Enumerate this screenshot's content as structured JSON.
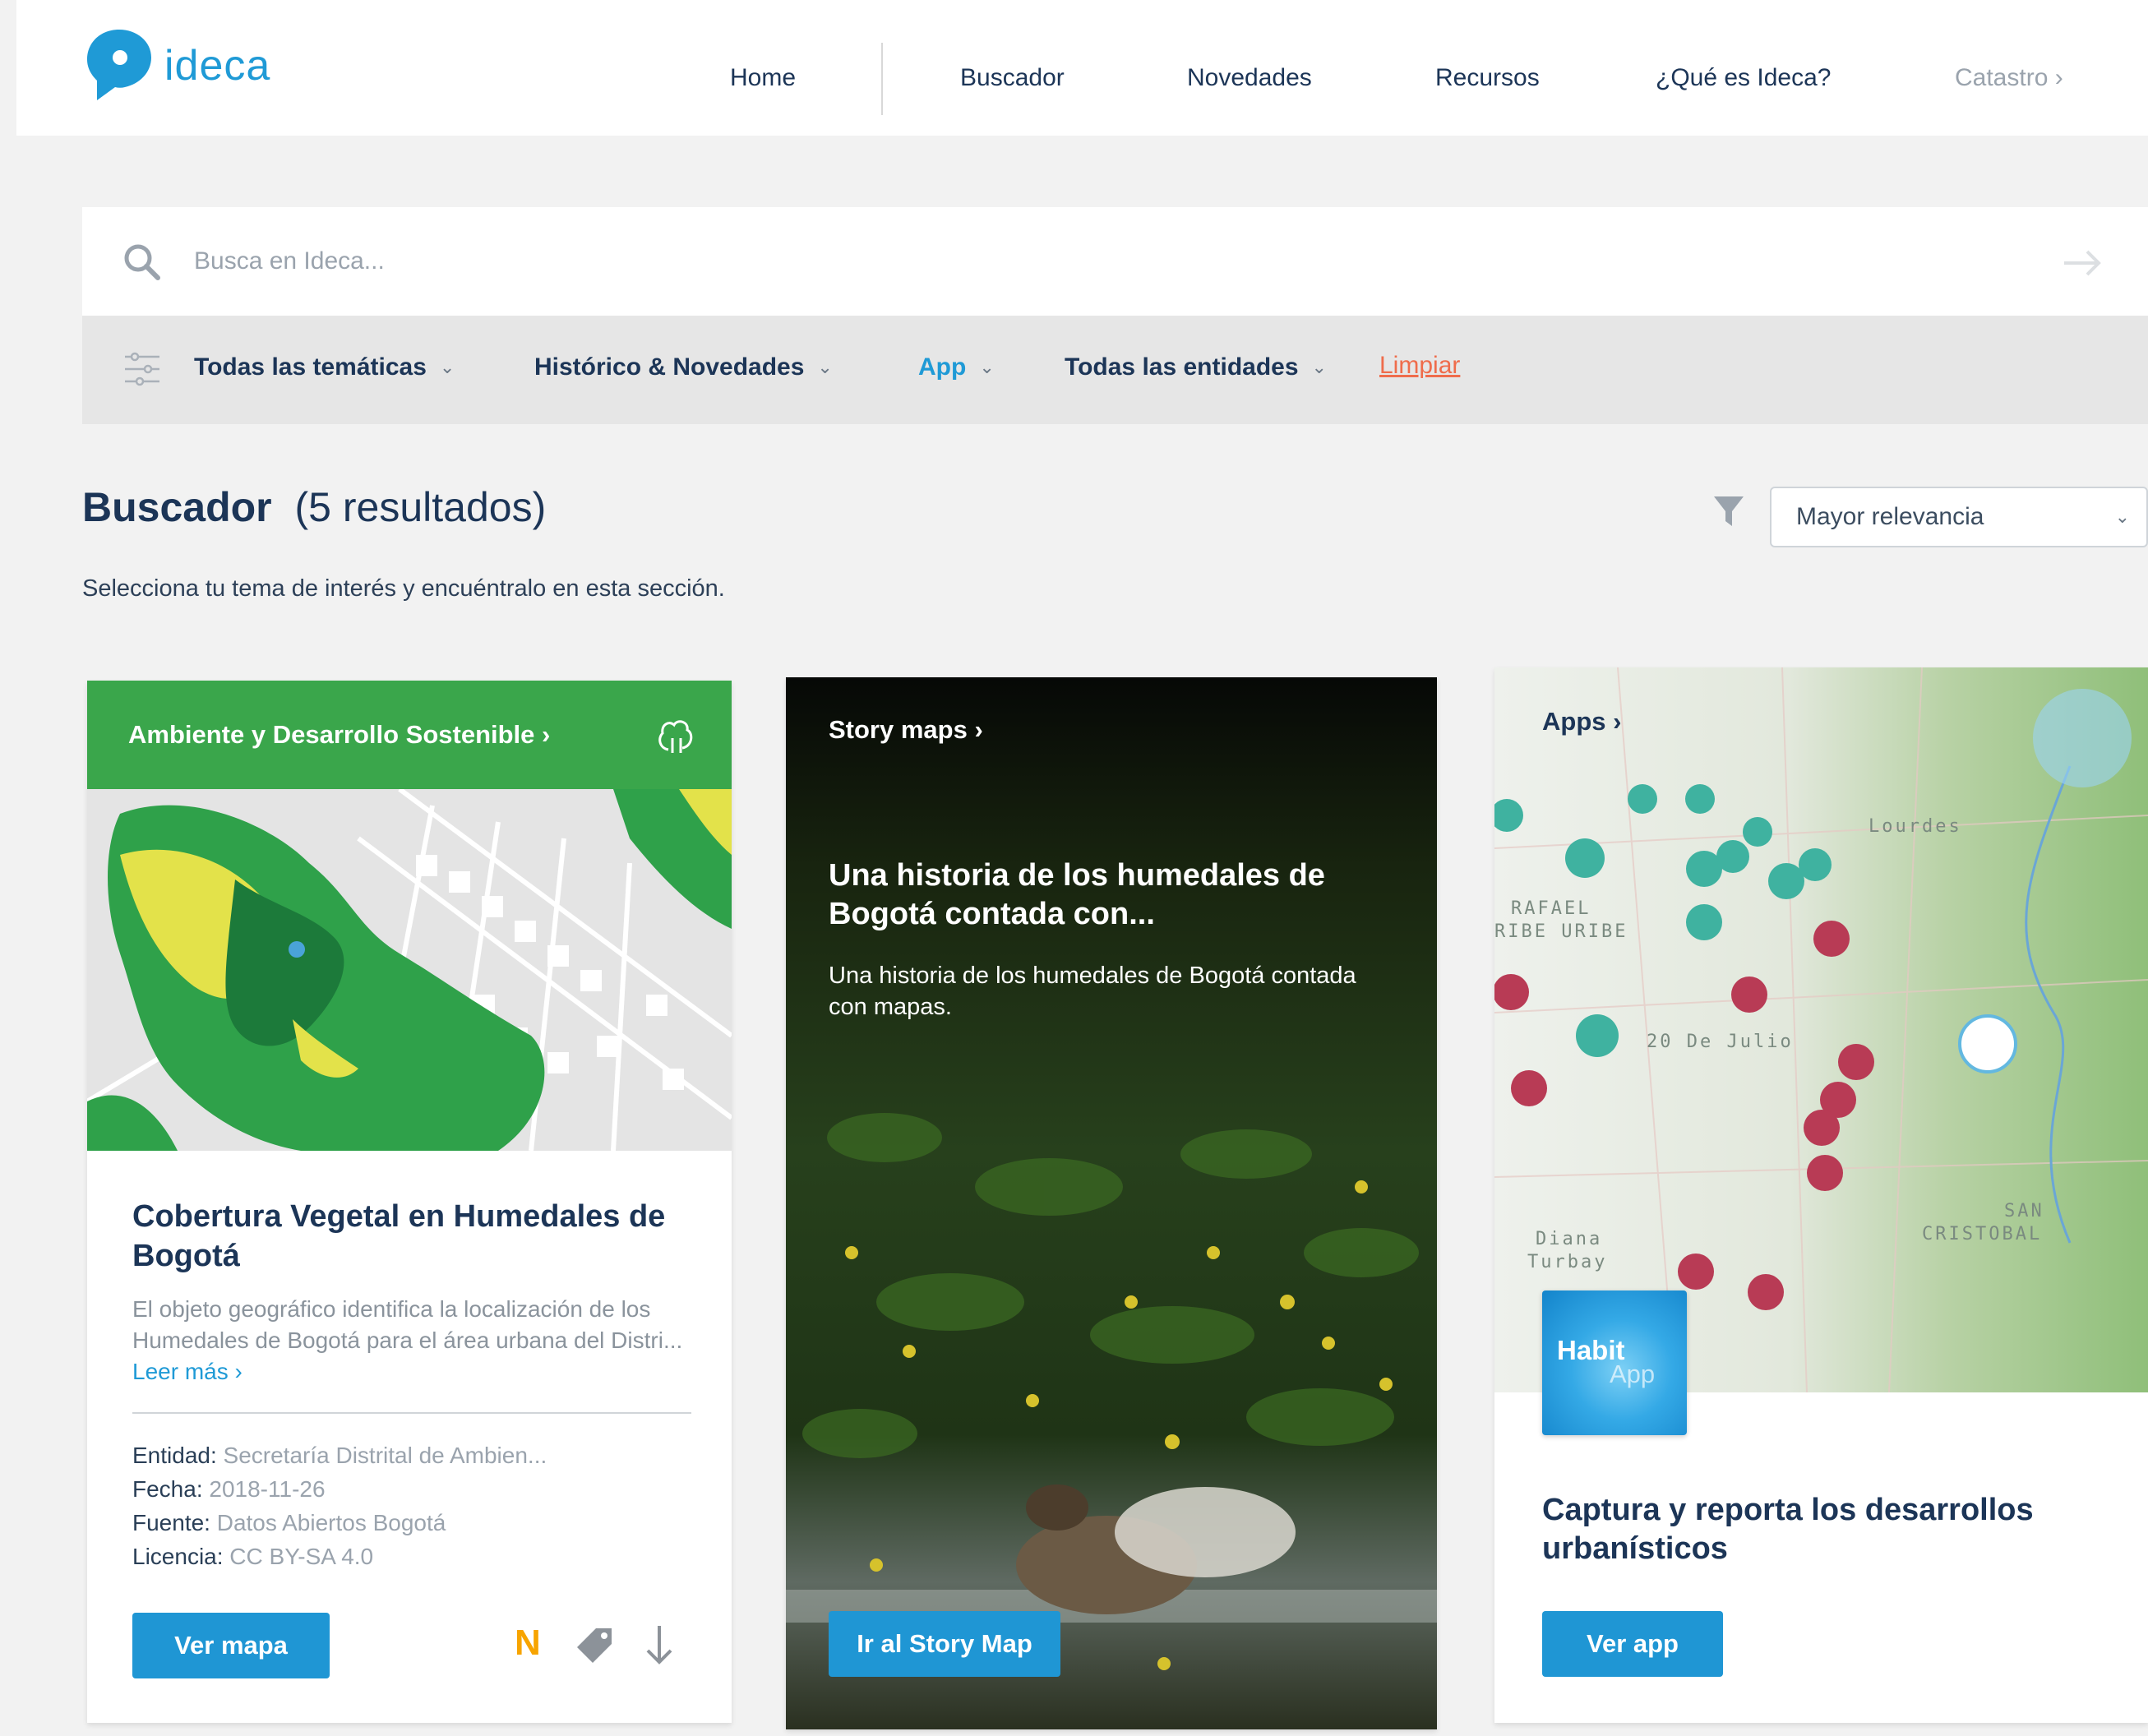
{
  "header": {
    "brand": "ideca",
    "nav": [
      "Home",
      "Buscador",
      "Novedades",
      "Recursos",
      "¿Qué es Ideca?",
      "Catastro ›"
    ],
    "accent_color": "#1f9ad6"
  },
  "search": {
    "placeholder": "Busca en Ideca...",
    "value": ""
  },
  "filters": {
    "tematica": "Todas las temáticas",
    "historico": "Histórico & Novedades",
    "tipo": "App",
    "entidades": "Todas las entidades",
    "clear": "Limpiar"
  },
  "results": {
    "title": "Buscador",
    "count": "(5 resultados)",
    "subtitle": "Selecciona tu tema de interés y encuéntralo en esta sección.",
    "sort": "Mayor relevancia"
  },
  "cards": [
    {
      "category": "Ambiente y Desarrollo Sostenible ›",
      "title": "Cobertura Vegetal en Humedales de Bogotá",
      "description": "El objeto geográfico identifica la localización de los Humedales de Bogotá para el área urbana del Distri...",
      "read_more": "Leer más ›",
      "meta": [
        {
          "key": "Entidad:",
          "value": "Secretaría Distrital de Ambien..."
        },
        {
          "key": "Fecha:",
          "value": "2018-11-26"
        },
        {
          "key": "Fuente:",
          "value": "Datos Abiertos Bogotá"
        },
        {
          "key": "Licencia:",
          "value": "CC BY-SA 4.0"
        }
      ],
      "button": "Ver mapa",
      "badge": "N",
      "category_color": "#3aa64b"
    },
    {
      "category": "Story maps ›",
      "title": "Una historia de los humedales de Bogotá contada con...",
      "description": "Una historia de los humedales de Bogotá contada con mapas.",
      "button": "Ir al Story Map"
    },
    {
      "category": "Apps ›",
      "map_labels": [
        "RAFAEL",
        "RIBE URIBE",
        "20 De Julio",
        "SAN",
        "CRISTOBAL",
        "Diana",
        "Turbay",
        "Lourdes"
      ],
      "app_name_1": "Habit",
      "app_name_2": "App",
      "title": "Captura y reporta los desarrollos urbanísticos",
      "button": "Ver app"
    }
  ],
  "icons": [
    "ideca-logo-icon",
    "search-icon",
    "arrow-right-icon",
    "filter-sliders-icon",
    "chevron-down-icon",
    "funnel-icon",
    "tree-icon",
    "tag-icon",
    "download-icon"
  ]
}
